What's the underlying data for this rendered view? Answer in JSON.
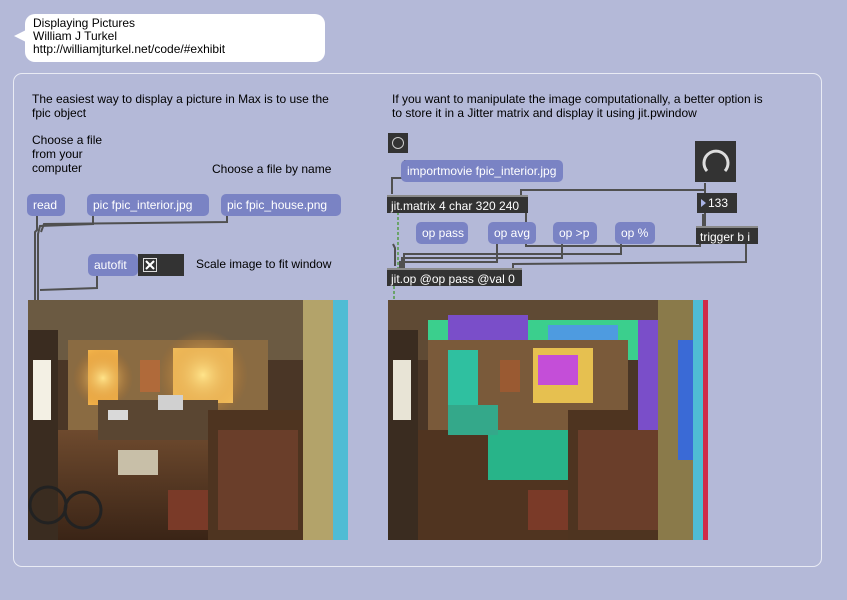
{
  "header": {
    "title": "Displaying Pictures",
    "author": "William J Turkel",
    "url": "http://williamjturkel.net/code/#exhibit"
  },
  "left": {
    "intro": "The easiest way to display a picture in Max is to use the fpic object",
    "choose_computer": "Choose a file from your computer",
    "choose_name": "Choose a file by name",
    "read_label": "read",
    "pic_interior_label": "pic fpic_interior.jpg",
    "pic_house_label": "pic fpic_house.png",
    "autofit_label": "autofit",
    "toggle_state": "on",
    "scale_comment": "Scale image to fit window"
  },
  "right": {
    "intro": "If you want to manipulate the image computationally, a better option is to store it in a Jitter matrix and display it using jit.pwindow",
    "importmovie_label": "importmovie fpic_interior.jpg",
    "jit_matrix_label": "jit.matrix 4 char 320 240",
    "op_pass_label": "op pass",
    "op_avg_label": "op avg",
    "op_gt_label": "op >p",
    "op_mod_label": "op %",
    "jit_op_label": "jit.op @op pass @val 0",
    "number_value": "133",
    "trigger_label": "trigger b i"
  },
  "colors": {
    "background": "#b4b9d8",
    "message_box": "#7a83c4",
    "object_box": "#333333",
    "cord": "#505050",
    "signal_cord": "#6aa36a"
  },
  "icons": {
    "bang": "bang-circle-icon",
    "dial": "dial-icon",
    "toggle": "toggle-x-icon"
  }
}
